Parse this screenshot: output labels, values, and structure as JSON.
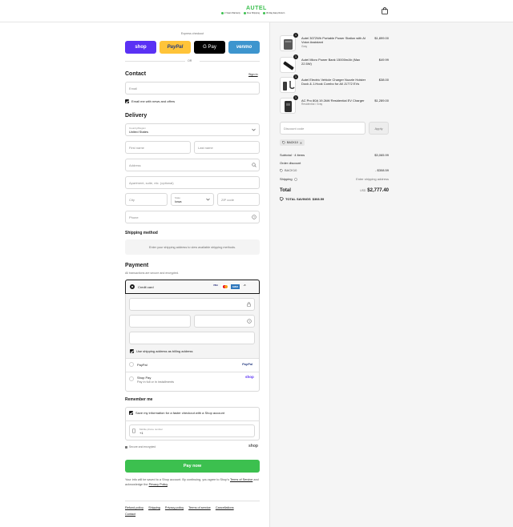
{
  "header": {
    "logo": "AUTEL",
    "badges": [
      "2 Years Warranty",
      "Free Shipping",
      "30-Day Easy Return"
    ],
    "cart_icon": "shopping-bag-icon"
  },
  "express": {
    "title": "Express checkout",
    "buttons": [
      "shop",
      "PayPal",
      "G Pay",
      "venmo"
    ],
    "or": "OR"
  },
  "contact": {
    "title": "Contact",
    "signin": "Sign in",
    "email_placeholder": "Email",
    "news_label": "Email me with news and offers"
  },
  "delivery": {
    "title": "Delivery",
    "country_label": "Country/Region",
    "country_value": "United States",
    "first_name": "First name",
    "last_name": "Last name",
    "address": "Address",
    "apartment": "Apartment, suite, etc. (optional)",
    "city": "City",
    "state_label": "State",
    "state_value": "Iowa",
    "zip": "ZIP code",
    "phone": "Phone"
  },
  "shipping": {
    "title": "Shipping method",
    "message": "Enter your shipping address to view available shipping methods."
  },
  "payment": {
    "title": "Payment",
    "subtitle": "All transactions are secure and encrypted.",
    "credit_card": "Credit card",
    "card_brands": [
      "VISA",
      "MC",
      "AMEX",
      "+5"
    ],
    "billing_label": "Use shipping address as billing address",
    "paypal": "PayPal",
    "paypal_logo": "PayPal",
    "shop_pay": "Shop Pay",
    "shop_pay_sub": "Pay in full or in installments",
    "shop_pay_logo": "shop"
  },
  "remember": {
    "title": "Remember me",
    "save_label": "Save my information for a faster checkout with a Shop account",
    "phone_label": "Mobile phone number",
    "phone_value": "+1",
    "secure": "Secure and encrypted",
    "shop_logo": "shop"
  },
  "pay_now": "Pay now",
  "legal": {
    "prefix": "Your info will be saved to a Shop account. By continuing, you agree to Shop's",
    "terms": "Terms of Service",
    "and": "and acknowledge the",
    "privacy": "Privacy Policy",
    "end": "."
  },
  "footer": [
    "Refund policy",
    "Shipping",
    "Privacy policy",
    "Terms of service",
    "Cancellations",
    "Contact"
  ],
  "cart": {
    "items": [
      {
        "qty": "1",
        "name": "Autel 3072Wh Portable Power Station with AI Voice Assistant",
        "variant": "Gray",
        "price": "$1,899.00"
      },
      {
        "qty": "1",
        "name": "Autel Micro Power Bank 15000mAh (Max 22.5W)",
        "variant": "",
        "price": "$49.99"
      },
      {
        "qty": "1",
        "name": "Autel Electric Vehicle Charger Nozzle Holster Dock & J-Hook Combo for All J1772 EVs",
        "variant": "",
        "price": "$38.00"
      },
      {
        "qty": "1",
        "name": "AC Pro 80A 19.2kW Residential EV Charger",
        "variant": "Residential / Gray",
        "price": "$1,289.00"
      }
    ],
    "discount_placeholder": "Discount code",
    "apply": "Apply",
    "code_tag": "BACK10",
    "subtotal_label": "Subtotal · 4 items",
    "subtotal": "$3,065.99",
    "order_discount_label": "Order discount",
    "discount_code": "BACK10",
    "discount_value": "- $308.59",
    "shipping_label": "Shipping",
    "shipping_value": "Enter shipping address",
    "total_label": "Total",
    "currency": "USD",
    "total": "$2,777.40",
    "savings_label": "TOTAL SAVINGS",
    "savings": "$308.59"
  },
  "colors": {
    "brand_green": "#3cc04f",
    "shop_purple": "#5a31f4",
    "paypal_yellow": "#ffc439",
    "venmo_blue": "#3d95ce"
  }
}
